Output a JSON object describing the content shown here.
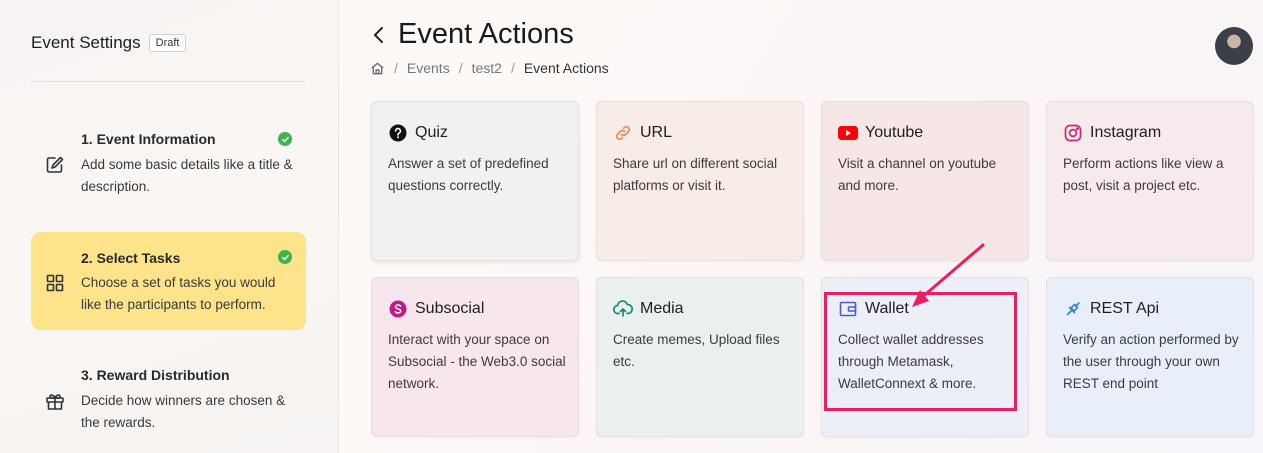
{
  "sidebar": {
    "title": "Event Settings",
    "badge": "Draft",
    "steps": [
      {
        "title": "1. Event Information",
        "desc": "Add some basic details like a title & description.",
        "icon": "edit-icon",
        "completed": true
      },
      {
        "title": "2. Select Tasks",
        "desc": "Choose a set of tasks you would like the participants to perform.",
        "icon": "grid-icon",
        "completed": true,
        "active": true
      },
      {
        "title": "3. Reward Distribution",
        "desc": "Decide how winners are chosen & the rewards.",
        "icon": "gift-icon",
        "completed": false
      }
    ]
  },
  "header": {
    "title": "Event Actions",
    "breadcrumb": [
      "Events",
      "test2",
      "Event Actions"
    ]
  },
  "cards": [
    {
      "title": "Quiz",
      "desc": "Answer a set of predefined questions correctly.",
      "icon": "question-icon"
    },
    {
      "title": "URL",
      "desc": "Share url on different social platforms or visit it.",
      "icon": "link-icon"
    },
    {
      "title": "Youtube",
      "desc": "Visit a channel on youtube and more.",
      "icon": "youtube-icon"
    },
    {
      "title": "Instagram",
      "desc": "Perform actions like view a post, visit a project etc.",
      "icon": "instagram-icon"
    },
    {
      "title": "Subsocial",
      "desc": "Interact with your space on Subsocial - the Web3.0 social network.",
      "icon": "subsocial-icon"
    },
    {
      "title": "Media",
      "desc": "Create memes, Upload files etc.",
      "icon": "upload-cloud-icon"
    },
    {
      "title": "Wallet",
      "desc": "Collect wallet addresses through Metamask, WalletConnext & more.",
      "icon": "wallet-icon"
    },
    {
      "title": "REST Api",
      "desc": "Verify an action performed by the user through your own REST end point",
      "icon": "api-plug-icon"
    }
  ],
  "colors": {
    "active_step": "#fde48a",
    "check": "#3fb34f",
    "highlight": "#ea1e63",
    "youtube": "#ff0000",
    "subsocial": "#c2188a"
  }
}
